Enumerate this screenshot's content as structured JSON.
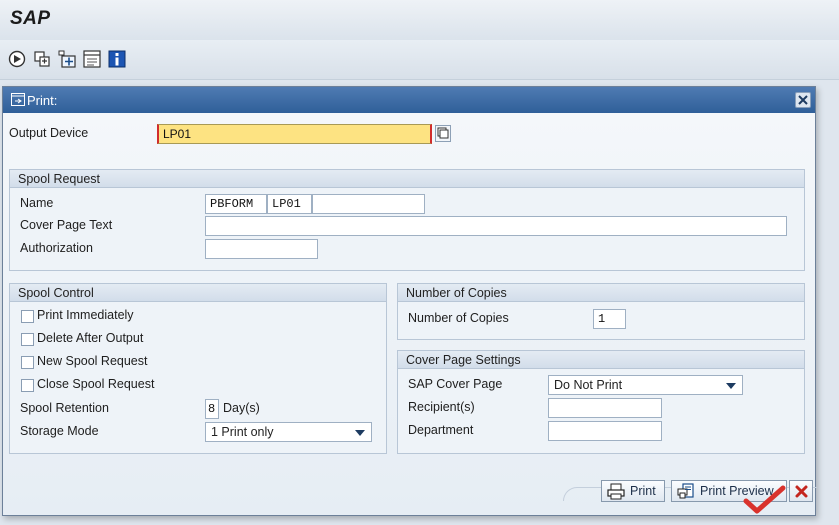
{
  "app": {
    "title": "SAP"
  },
  "toolbar": {
    "icons": [
      "execute-icon",
      "copy-icon",
      "expand-icon",
      "layout-icon",
      "info-icon"
    ]
  },
  "dialog": {
    "title": "Print:",
    "output_device_label": "Output Device",
    "output_device_value": "LP01",
    "spool_request": {
      "heading": "Spool Request",
      "name_label": "Name",
      "name_part1": "PBFORM",
      "name_part2": "LP01",
      "name_part3": "",
      "cover_text_label": "Cover Page Text",
      "cover_text_value": "",
      "authorization_label": "Authorization",
      "authorization_value": ""
    },
    "spool_control": {
      "heading": "Spool Control",
      "print_immediately": "Print Immediately",
      "delete_after_output": "Delete After Output",
      "new_spool_request": "New Spool Request",
      "close_spool_request": "Close Spool Request",
      "retention_label": "Spool Retention",
      "retention_value": "8",
      "retention_unit": "Day(s)",
      "storage_mode_label": "Storage Mode",
      "storage_mode_value": "1 Print only"
    },
    "copies": {
      "heading": "Number of Copies",
      "label": "Number of Copies",
      "value": "1"
    },
    "cover_page": {
      "heading": "Cover Page Settings",
      "sap_cover_label": "SAP Cover Page",
      "sap_cover_value": "Do Not Print",
      "recipient_label": "Recipient(s)",
      "recipient_value": "",
      "department_label": "Department",
      "department_value": ""
    },
    "buttons": {
      "print": "Print",
      "print_preview": "Print Preview"
    }
  },
  "colors": {
    "title_bar": "#2f5f99",
    "required_field": "#fde382",
    "required_marker": "#d12c2c",
    "checkmark": "#d9322c"
  }
}
